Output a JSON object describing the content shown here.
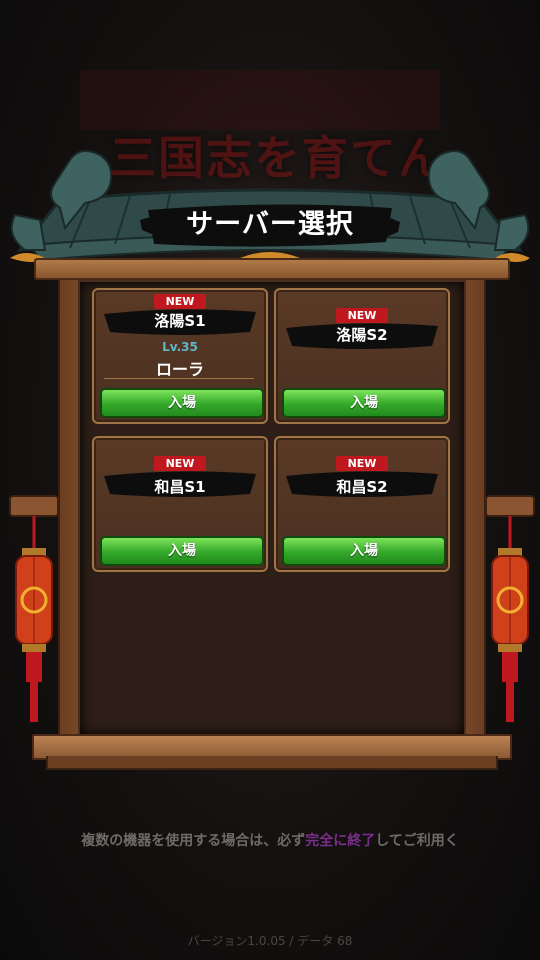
{
  "background": {
    "title_text": "三国志を育てん"
  },
  "header": {
    "title": "サーバー選択"
  },
  "servers": [
    {
      "badge": "NEW",
      "name": "洛陽S1",
      "level": "Lv.35",
      "player": "ローラ",
      "enter_label": "入場"
    },
    {
      "badge": "NEW",
      "name": "洛陽S2",
      "enter_label": "入場"
    },
    {
      "badge": "NEW",
      "name": "和昌S1",
      "enter_label": "入場"
    },
    {
      "badge": "NEW",
      "name": "和昌S2",
      "enter_label": "入場"
    }
  ],
  "footer": {
    "notice_before": "複数の機器を使用する場合は、必ず",
    "notice_highlight": "完全に終了",
    "notice_after": "してご利用く",
    "version": "バージョン1.0.05 / データ 68"
  },
  "colors": {
    "accent_red": "#c0181f",
    "button_green": "#34a82a",
    "level_blue": "#5fb6c9",
    "highlight_purple": "#7a2f8c"
  }
}
